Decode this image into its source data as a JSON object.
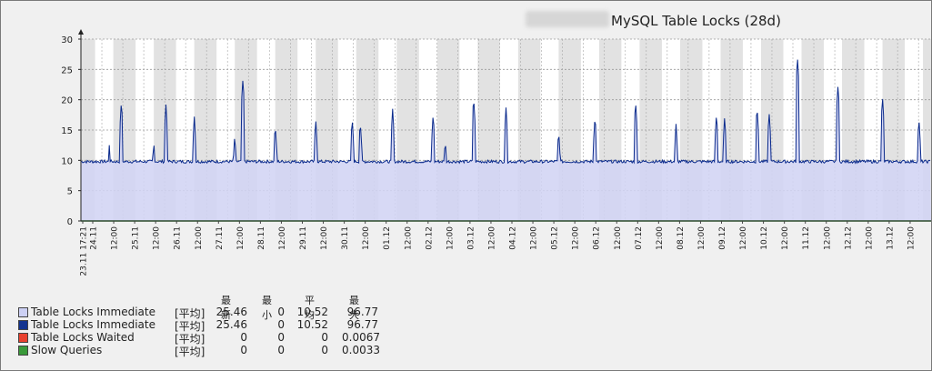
{
  "title": "MySQL Table Locks (28d)",
  "chart_data": {
    "type": "line",
    "title": "MySQL Table Locks (28d)",
    "ylim": [
      0,
      30
    ],
    "yticks": [
      0,
      5,
      10,
      15,
      20,
      25,
      30
    ],
    "grid": true,
    "x_ticks": [
      {
        "label": "23.11 17:21",
        "red": true
      },
      {
        "label": "24.11",
        "red": true
      },
      {
        "label": "12:00",
        "red": false
      },
      {
        "label": "25.11",
        "red": true
      },
      {
        "label": "12:00",
        "red": false
      },
      {
        "label": "26.11",
        "red": false
      },
      {
        "label": "12:00",
        "red": false
      },
      {
        "label": "27.11",
        "red": true
      },
      {
        "label": "12:00",
        "red": false
      },
      {
        "label": "28.11",
        "red": true
      },
      {
        "label": "12:00",
        "red": false
      },
      {
        "label": "29.11",
        "red": false
      },
      {
        "label": "12:00",
        "red": false
      },
      {
        "label": "30.11",
        "red": true
      },
      {
        "label": "12:00",
        "red": false
      },
      {
        "label": "01.12",
        "red": true
      },
      {
        "label": "12:00",
        "red": false
      },
      {
        "label": "02.12",
        "red": true
      },
      {
        "label": "12:00",
        "red": false
      },
      {
        "label": "03.12",
        "red": true
      },
      {
        "label": "12:00",
        "red": false
      },
      {
        "label": "04.12",
        "red": true
      },
      {
        "label": "12:00",
        "red": false
      },
      {
        "label": "05.12",
        "red": true
      },
      {
        "label": "12:00",
        "red": false
      },
      {
        "label": "06.12",
        "red": false
      },
      {
        "label": "12:00",
        "red": false
      },
      {
        "label": "07.12",
        "red": true
      },
      {
        "label": "12:00",
        "red": false
      },
      {
        "label": "08.12",
        "red": true
      },
      {
        "label": "12:00",
        "red": false
      },
      {
        "label": "09.12",
        "red": true
      },
      {
        "label": "12:00",
        "red": false
      },
      {
        "label": "10.12",
        "red": true
      },
      {
        "label": "12:00",
        "red": false
      },
      {
        "label": "11.12",
        "red": true
      },
      {
        "label": "12:00",
        "red": false
      },
      {
        "label": "12.12",
        "red": true
      },
      {
        "label": "12:00",
        "red": false
      },
      {
        "label": "13.12",
        "red": true
      },
      {
        "label": "12:00",
        "red": false
      }
    ],
    "baseline": 9.8,
    "peaks": [
      [
        0.7,
        12.5
      ],
      [
        1.0,
        19.8
      ],
      [
        1.8,
        13.2
      ],
      [
        2.1,
        19.2
      ],
      [
        2.8,
        17.2
      ],
      [
        3.8,
        14.3
      ],
      [
        4.0,
        23.5
      ],
      [
        4.8,
        16.0
      ],
      [
        5.8,
        16.8
      ],
      [
        6.7,
        17.0
      ],
      [
        6.9,
        16.5
      ],
      [
        7.7,
        18.5
      ],
      [
        8.7,
        17.8
      ],
      [
        9.0,
        13.5
      ],
      [
        9.7,
        20.5
      ],
      [
        10.5,
        18.7
      ],
      [
        11.8,
        15.0
      ],
      [
        12.7,
        17.5
      ],
      [
        13.7,
        19.8
      ],
      [
        14.7,
        16.0
      ],
      [
        15.7,
        17.8
      ],
      [
        15.9,
        17.3
      ],
      [
        16.7,
        19.0
      ],
      [
        17.0,
        18.0
      ],
      [
        17.7,
        27.0
      ],
      [
        18.7,
        22.5
      ],
      [
        19.8,
        20.5
      ],
      [
        20.7,
        17.0
      ]
    ],
    "series": [
      {
        "name": "Table Locks Immediate",
        "color": "#d1d4f4",
        "style": "area"
      },
      {
        "name": "Table Locks Immediate",
        "color": "#0a2a8c",
        "style": "line"
      },
      {
        "name": "Table Locks Waited",
        "color": "#ef3b2c",
        "style": "line"
      },
      {
        "name": "Slow Queries",
        "color": "#3a9a3a",
        "style": "line"
      }
    ]
  },
  "legend": {
    "headers": [
      "最新",
      "最小",
      "平均",
      "最大"
    ],
    "rows": [
      {
        "color": "#ccd0f4",
        "name": "Table Locks Immediate",
        "tag": "[平均]",
        "latest": "25.46",
        "min": "0",
        "avg": "10.52",
        "max": "96.77"
      },
      {
        "color": "#13338f",
        "name": "Table Locks Immediate",
        "tag": "[平均]",
        "latest": "25.46",
        "min": "0",
        "avg": "10.52",
        "max": "96.77"
      },
      {
        "color": "#e8412f",
        "name": "Table Locks Waited",
        "tag": "[平均]",
        "latest": "0",
        "min": "0",
        "avg": "0",
        "max": "0.0067"
      },
      {
        "color": "#3a9a3a",
        "name": "Slow Queries",
        "tag": "[平均]",
        "latest": "0",
        "min": "0",
        "avg": "0",
        "max": "0.0033"
      }
    ]
  }
}
